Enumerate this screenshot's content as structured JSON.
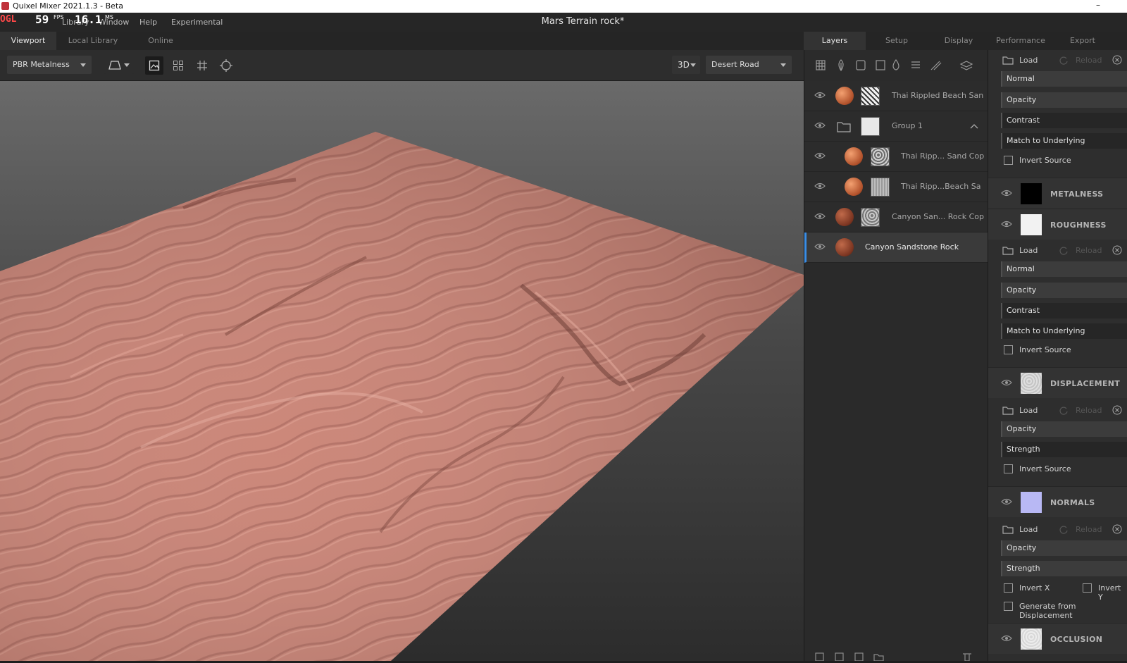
{
  "window": {
    "title": "Quixel Mixer 2021.1.3 - Beta",
    "minimize_glyph": "–"
  },
  "overlay": {
    "ogl": "OGL",
    "fps_value": "59",
    "fps_label": "FPS",
    "ms_value": "16.1",
    "ms_label": "MS"
  },
  "menu": {
    "library": "Library",
    "window": "Window",
    "help": "Help",
    "experimental": "Experimental"
  },
  "document_title": "Mars Terrain rock*",
  "viewport_tabs": {
    "viewport": "Viewport",
    "local_library": "Local Library",
    "online": "Online"
  },
  "toolbar": {
    "shading_mode": "PBR Metalness",
    "view_mode": "3D",
    "environment": "Desert Road"
  },
  "panel_tabs": {
    "layers": "Layers",
    "setup": "Setup",
    "display": "Display",
    "performance": "Performance",
    "export": "Export"
  },
  "layers": [
    {
      "name": "Thai Rippled Beach San"
    },
    {
      "name": "Group 1"
    },
    {
      "name": "Thai Ripp... Sand Cop"
    },
    {
      "name": "Thai Ripp...Beach Sa"
    },
    {
      "name": "Canyon San... Rock Cop"
    },
    {
      "name": "Canyon Sandstone Rock"
    }
  ],
  "props": {
    "load": "Load",
    "reload": "Reload",
    "blend_mode": "Normal",
    "opacity": "Opacity",
    "contrast": "Contrast",
    "match": "Match to Underlying",
    "invert_source": "Invert Source",
    "strength": "Strength",
    "invert_x": "Invert X",
    "invert_y": "Invert Y",
    "generate": "Generate from Displacement",
    "sections": {
      "metalness": "METALNESS",
      "roughness": "ROUGHNESS",
      "displacement": "DISPLACEMENT",
      "normals": "NORMALS",
      "occlusion": "OCCLUSION"
    }
  },
  "colors": {
    "accent_blue": "#3a8ee6",
    "terrain": "#c97b6c",
    "ogl_red": "#ff4848"
  }
}
